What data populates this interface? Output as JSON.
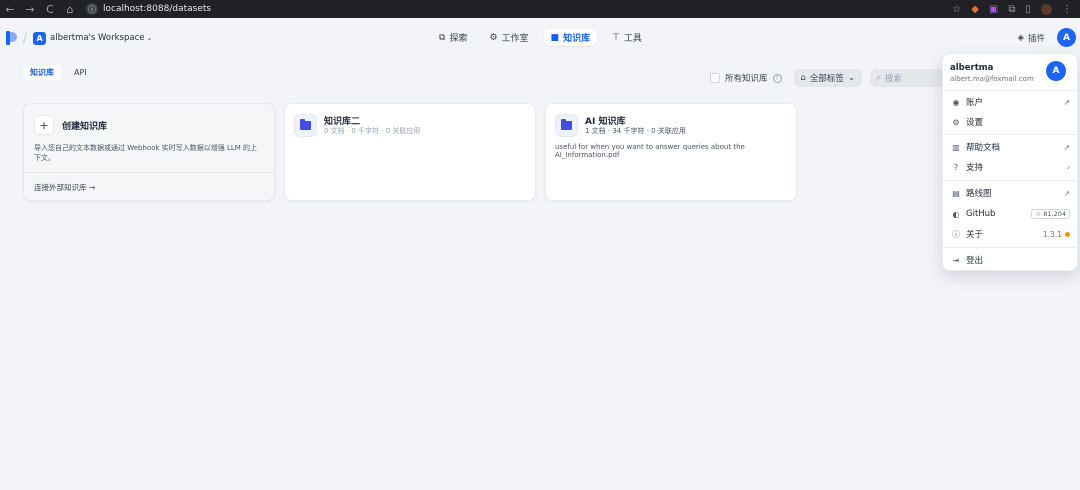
{
  "browser": {
    "back": "←",
    "forward": "→",
    "reload": "C",
    "home": "⌂",
    "url": "localhost:8088/datasets"
  },
  "header": {
    "workspace_initial": "A",
    "workspace_name": "albertma's Workspace",
    "nav": [
      {
        "label": "探索",
        "icon": "explore-icon"
      },
      {
        "label": "工作室",
        "icon": "studio-icon"
      },
      {
        "label": "知识库",
        "icon": "knowledge-icon",
        "active": true
      },
      {
        "label": "工具",
        "icon": "tools-icon"
      }
    ],
    "plugins_label": "插件",
    "user_initial": "A"
  },
  "sub_tabs": [
    {
      "label": "知识库",
      "active": true
    },
    {
      "label": "API",
      "active": false
    }
  ],
  "filters": {
    "all_kb_label": "所有知识库",
    "all_tags_label": "全部标签",
    "search_placeholder": "搜索"
  },
  "create_card": {
    "title": "创建知识库",
    "description": "导入您自己的文本数据或通过 Webhook 实时写入数据以增强 LLM 的上下文。",
    "link": "连接外部知识库 →"
  },
  "datasets": [
    {
      "name": "知识库二",
      "meta": "0 文档 · 0 千字符 · 0 关联应用",
      "description": ""
    },
    {
      "name": "AI 知识库",
      "meta": "1 文档 · 34 千字符 · 0 关联应用",
      "description": "useful for when you want to answer queries about the AI_Information.pdf"
    }
  ],
  "menu": {
    "user": "albertma",
    "email": "albert.ma@foxmail.com",
    "avatar_initial": "A",
    "items": {
      "account": "账户",
      "settings": "设置",
      "help_docs": "帮助文档",
      "support": "支持",
      "roadmap": "路线图",
      "github": "GitHub",
      "github_stars": "☆ 81,204",
      "about": "关于",
      "version": "1.3.1",
      "logout": "登出"
    }
  },
  "colors": {
    "accent": "#155eef",
    "brand_blue": "#1c64f2",
    "page_bg": "#f2f4f7",
    "version_dot": "#f79009"
  }
}
